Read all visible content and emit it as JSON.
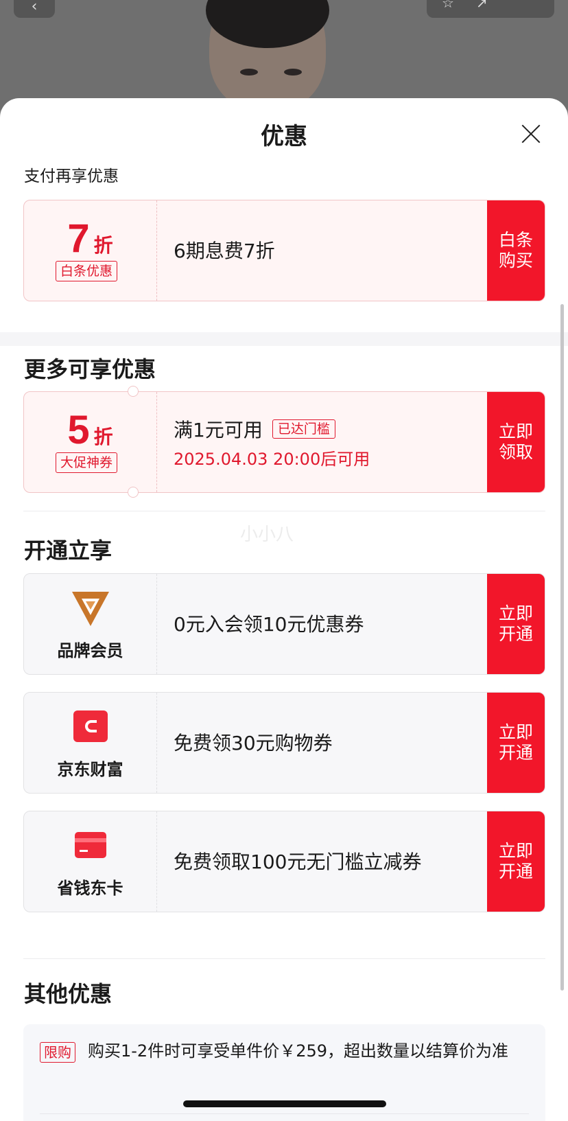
{
  "sheet": {
    "title": "优惠"
  },
  "payment": {
    "section_title": "支付再享优惠",
    "card": {
      "rate": "7",
      "unit": "折",
      "tag": "白条优惠",
      "desc": "6期息费7折",
      "action": "白条购买"
    }
  },
  "more": {
    "section_title": "更多可享优惠",
    "card": {
      "rate": "5",
      "unit": "折",
      "tag": "大促神券",
      "desc": "满1元可用",
      "badge": "已达门槛",
      "sub": "2025.04.03 20:00后可用",
      "action": "立即领取"
    }
  },
  "membership": {
    "section_title": "开通立享",
    "cards": [
      {
        "icon": "brand-v-icon",
        "name": "品牌会员",
        "desc": "0元入会领10元优惠券",
        "action": "立即开通"
      },
      {
        "icon": "jd-finance-icon",
        "name": "京东财富",
        "desc": "免费领30元购物券",
        "action": "立即开通"
      },
      {
        "icon": "card-icon",
        "name": "省钱东卡",
        "desc": "免费领取100元无门槛立减券",
        "action": "立即开通"
      }
    ]
  },
  "other": {
    "section_title": "其他优惠",
    "items": [
      {
        "tag": "限购",
        "text": "购买1-2件时可享受单件价￥259，超出数量以结算价为准"
      }
    ]
  },
  "watermark": "小小八",
  "colors": {
    "accent": "#f2162a",
    "brand_gold": "#c8762a"
  }
}
